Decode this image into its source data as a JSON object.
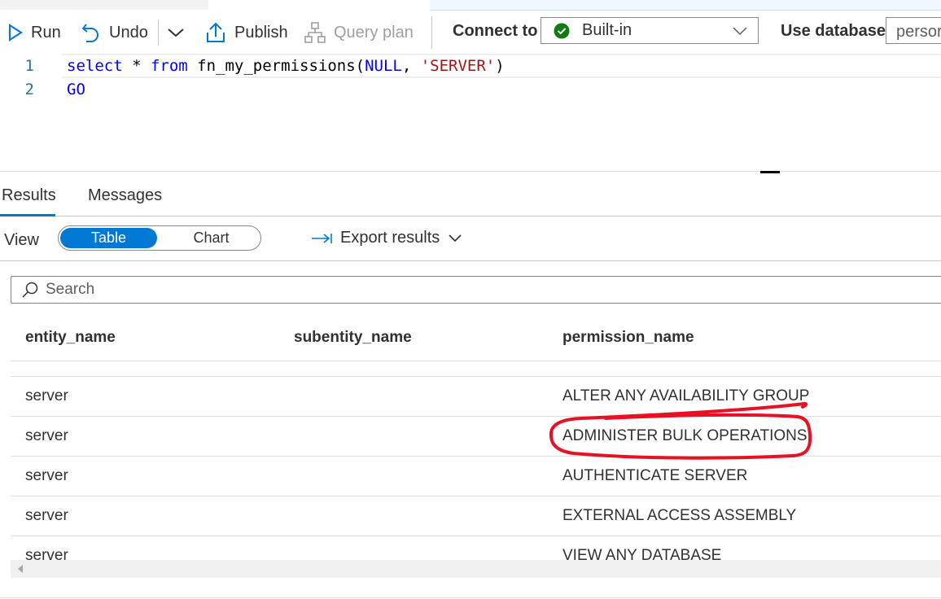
{
  "toolbar": {
    "run_label": "Run",
    "undo_label": "Undo",
    "publish_label": "Publish",
    "query_plan_label": "Query plan",
    "connect_to_label": "Connect to",
    "connection_value": "Built-in",
    "use_database_label": "Use database",
    "database_value": "persor"
  },
  "editor": {
    "lines": [
      {
        "number": "1"
      },
      {
        "number": "2",
        "text": "GO"
      }
    ],
    "line1": {
      "kw_select": "select",
      "star": " * ",
      "kw_from": "from",
      "func": " fn_my_permissions(",
      "null": "NULL",
      "comma": ", ",
      "str": "'SERVER'",
      "close": ")"
    }
  },
  "results_tabs": {
    "results": "Results",
    "messages": "Messages"
  },
  "view": {
    "label": "View",
    "table": "Table",
    "chart": "Chart",
    "export": "Export results"
  },
  "search": {
    "placeholder": "Search"
  },
  "table": {
    "columns": [
      "entity_name",
      "subentity_name",
      "permission_name"
    ],
    "rows": [
      [
        "server",
        "",
        "ALTER ANY AVAILABILITY GROUP"
      ],
      [
        "server",
        "",
        "ADMINISTER BULK OPERATIONS"
      ],
      [
        "server",
        "",
        "AUTHENTICATE SERVER"
      ],
      [
        "server",
        "",
        "EXTERNAL ACCESS ASSEMBLY"
      ],
      [
        "server",
        "",
        "VIEW ANY DATABASE"
      ]
    ]
  },
  "colors": {
    "accent": "#0078d4",
    "success": "#107c10",
    "annotation": "#e81123"
  },
  "icons": {
    "run": "play-icon",
    "undo": "undo-icon",
    "publish": "upload-icon",
    "query_plan": "hierarchy-icon",
    "search": "search-icon",
    "export": "arrow-right-bar-icon"
  }
}
